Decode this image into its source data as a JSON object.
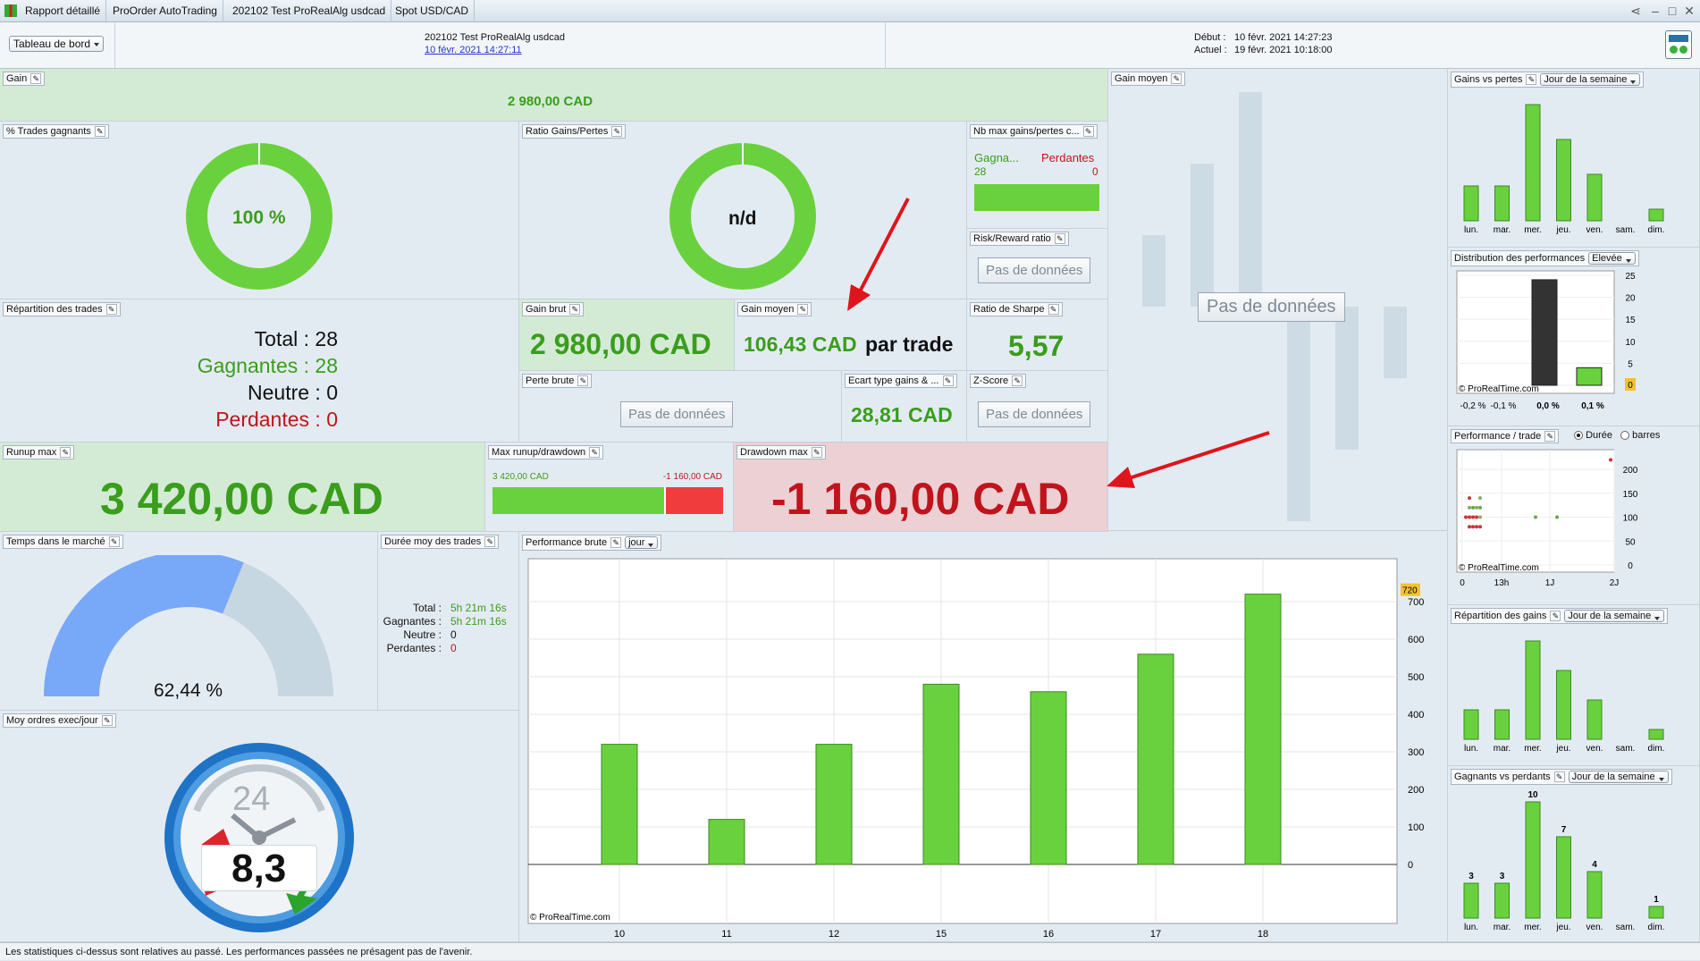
{
  "titlebar": {
    "tabs": [
      "Rapport détaillé",
      "ProOrder AutoTrading",
      "202102 Test ProRealAlg usdcad",
      "Spot USD/CAD"
    ]
  },
  "header": {
    "dashboard": "Tableau de bord",
    "name": "202102 Test ProRealAlg usdcad",
    "date_link": "10 févr. 2021 14:27:11",
    "debut_label": "Début :",
    "debut_value": "10 févr. 2021 14:27:23",
    "actuel_label": "Actuel :",
    "actuel_value": "19 févr. 2021 10:18:00"
  },
  "gain": {
    "label": "Gain",
    "value": "2 980,00 CAD"
  },
  "trades_gagnants": {
    "label": "% Trades gagnants",
    "value": "100 %",
    "percent": 100
  },
  "ratio": {
    "label": "Ratio Gains/Pertes",
    "value": "n/d"
  },
  "nbmax": {
    "label": "Nb max gains/pertes c...",
    "win_label": "Gagna...",
    "loss_label": "Perdantes",
    "win": "28",
    "loss": "0"
  },
  "riskreward": {
    "label": "Risk/Reward ratio",
    "nodata": "Pas de données"
  },
  "gain_moyen_chart": {
    "label": "Gain moyen",
    "nodata": "Pas de données"
  },
  "repartition": {
    "label": "Répartition des trades",
    "total": "Total : 28",
    "gagnantes": "Gagnantes : 28",
    "neutre": "Neutre : 0",
    "perdantes": "Perdantes : 0"
  },
  "gain_brut": {
    "label": "Gain brut",
    "value": "2 980,00 CAD"
  },
  "gain_moyen": {
    "label": "Gain moyen",
    "value": "106,43 CAD",
    "suffix": "par trade"
  },
  "sharpe": {
    "label": "Ratio de Sharpe",
    "value": "5,57"
  },
  "perte_brute": {
    "label": "Perte brute",
    "nodata": "Pas de données"
  },
  "ecart": {
    "label": "Ecart type gains & ...",
    "value": "28,81 CAD"
  },
  "zscore": {
    "label": "Z-Score",
    "nodata": "Pas de données"
  },
  "runup": {
    "label": "Runup max",
    "value": "3 420,00 CAD"
  },
  "maxrunup": {
    "label": "Max runup/drawdown",
    "runup": "3 420,00 CAD",
    "drawdown": "-1 160,00 CAD",
    "runup_value": 3420,
    "drawdown_value": -1160
  },
  "drawdown": {
    "label": "Drawdown max",
    "value": "-1 160,00 CAD"
  },
  "temps": {
    "label": "Temps dans le marché",
    "value": "62,44 %",
    "percent": 62.44
  },
  "duree": {
    "label": "Durée moy des trades",
    "rows": [
      {
        "k": "Total :",
        "v": "5h 21m 16s"
      },
      {
        "k": "Gagnantes :",
        "v": "5h 21m 16s"
      },
      {
        "k": "Neutre :",
        "v": "0"
      },
      {
        "k": "Perdantes :",
        "v": "0"
      }
    ]
  },
  "perf_brute": {
    "label": "Performance brute",
    "period": "jour",
    "watermark": "© ProRealTime.com",
    "last": "720"
  },
  "moy_ordres": {
    "label": "Moy ordres exec/jour",
    "value": "8,3",
    "clock": "24"
  },
  "gains_pertes": {
    "label": "Gains vs pertes",
    "period": "Jour de la semaine"
  },
  "distribution": {
    "label": "Distribution des performances",
    "level": "Elevée",
    "watermark": "© ProRealTime.com",
    "highlight": "0"
  },
  "perf_trade": {
    "label": "Performance / trade",
    "opt1": "Durée",
    "opt2": "barres",
    "watermark": "© ProRealTime.com"
  },
  "repartition_gains": {
    "label": "Répartition des gains",
    "period": "Jour de la semaine"
  },
  "gagnants_perdants": {
    "label": "Gagnants vs perdants",
    "period": "Jour de la semaine"
  },
  "footer": "Les statistiques ci-dessus sont relatives au passé. Les performances passées ne présagent pas de l'avenir.",
  "colors": {
    "green": "#6ad13e",
    "red": "#f03c3c",
    "blue": "#78a8f8"
  },
  "chart_data": [
    {
      "type": "bar",
      "title": "Performance brute",
      "categories": [
        "10",
        "11",
        "12",
        "15",
        "16",
        "17",
        "18"
      ],
      "values": [
        320,
        120,
        320,
        480,
        460,
        560,
        720
      ],
      "ylim": [
        0,
        750
      ],
      "yticks": [
        0,
        100,
        200,
        300,
        400,
        500,
        600,
        700
      ]
    },
    {
      "type": "bar",
      "title": "Gains vs pertes",
      "categories": [
        "lun.",
        "mar.",
        "mer.",
        "jeu.",
        "ven.",
        "sam.",
        "dim."
      ],
      "values": [
        3,
        3,
        10,
        7,
        4,
        0,
        1
      ]
    },
    {
      "type": "bar",
      "title": "Distribution des performances",
      "categories": [
        "-0,2 %",
        "-0,1 %",
        "0,0 %",
        "0,1 %"
      ],
      "values": [
        0,
        0,
        24,
        4
      ],
      "ylim": [
        0,
        25
      ],
      "yticks": [
        0,
        5,
        10,
        15,
        20,
        25
      ]
    },
    {
      "type": "scatter",
      "title": "Performance / trade",
      "xticks": [
        "0",
        "13h",
        "1J",
        "2J"
      ],
      "yticks": [
        0,
        50,
        100,
        150,
        200
      ],
      "ylim": [
        0,
        230
      ]
    },
    {
      "type": "bar",
      "title": "Répartition des gains",
      "categories": [
        "lun.",
        "mar.",
        "mer.",
        "jeu.",
        "ven.",
        "sam.",
        "dim."
      ],
      "values": [
        3,
        3,
        10,
        7,
        4,
        0,
        1
      ]
    },
    {
      "type": "bar",
      "title": "Gagnants vs perdants",
      "categories": [
        "lun.",
        "mar.",
        "mer.",
        "jeu.",
        "ven.",
        "sam.",
        "dim."
      ],
      "values": [
        3,
        3,
        10,
        7,
        4,
        0,
        1
      ]
    }
  ]
}
